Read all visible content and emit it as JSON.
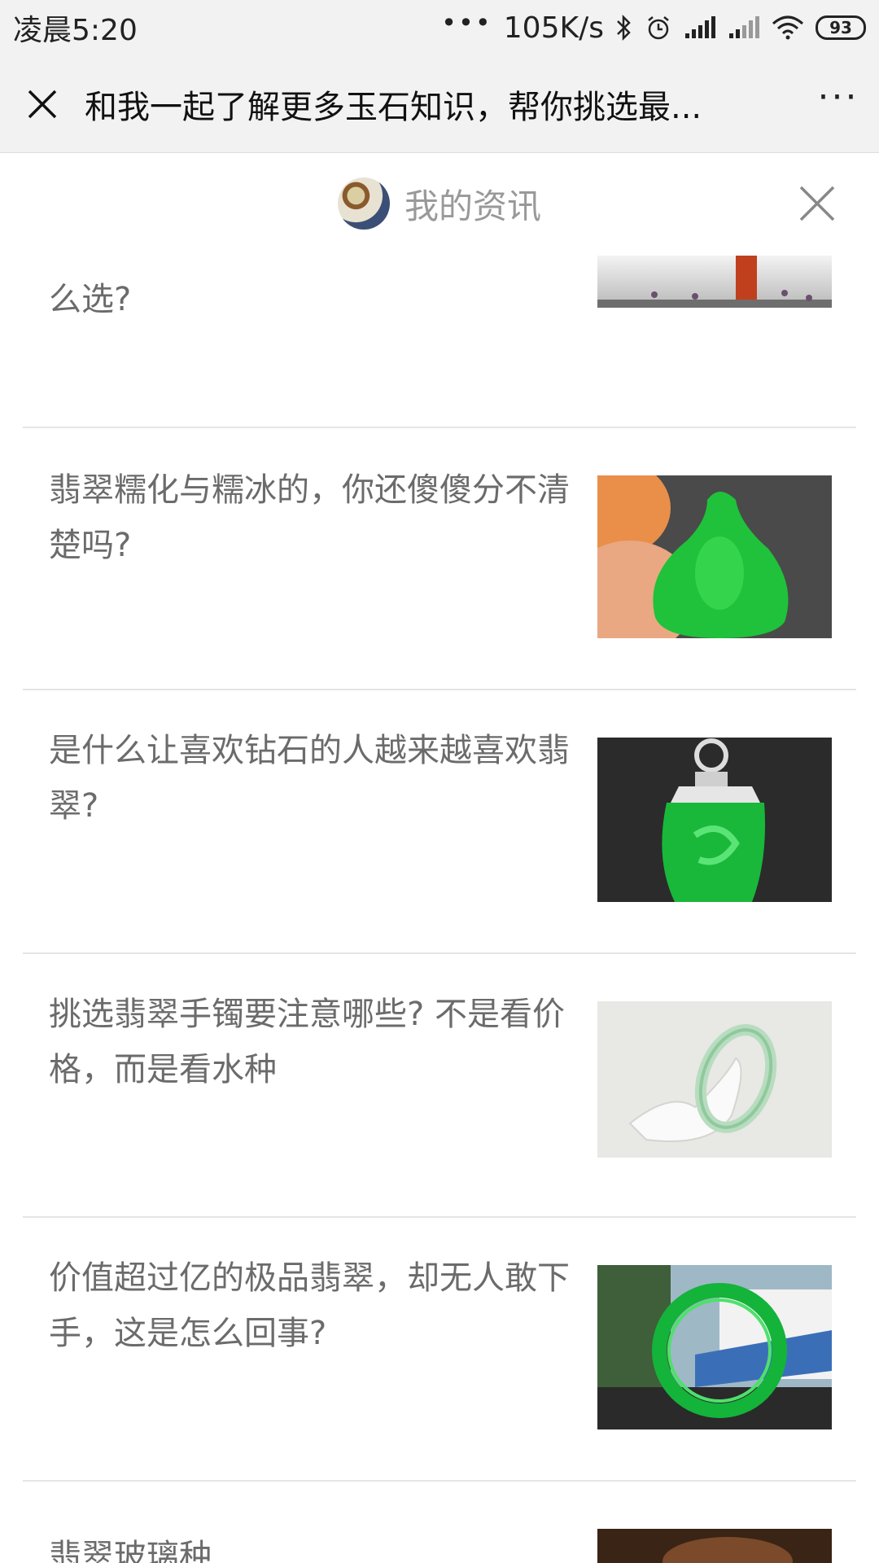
{
  "status_bar": {
    "time": "凌晨5:20",
    "dots": "•••",
    "speed": "105K/s",
    "battery": "93",
    "icons": [
      "bluetooth-icon",
      "alarm-icon",
      "signal-icon",
      "signal-icon",
      "wifi-icon",
      "battery-icon"
    ]
  },
  "nav": {
    "title": "和我一起了解更多玉石知识，帮你挑选最...",
    "more": "···"
  },
  "panel": {
    "title": "我的资讯"
  },
  "articles": [
    {
      "title": "么选?"
    },
    {
      "title": "翡翠糯化与糯冰的，你还傻傻分不清楚吗?"
    },
    {
      "title": "是什么让喜欢钻石的人越来越喜欢翡翠?"
    },
    {
      "title": "挑选翡翠手镯要注意哪些? 不是看价格，而是看水种"
    },
    {
      "title": "价值超过亿的极品翡翠，却无人敢下手，这是怎么回事?"
    },
    {
      "title": "翡翠玻璃种"
    }
  ]
}
